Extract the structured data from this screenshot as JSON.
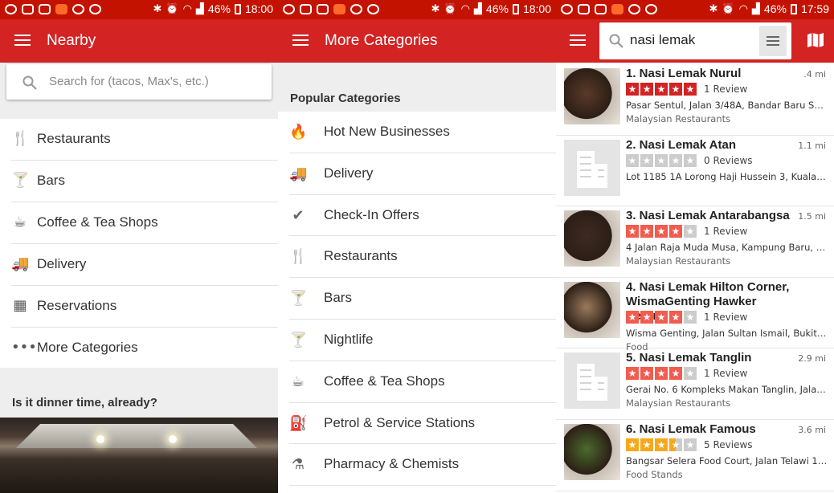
{
  "screen1": {
    "status": {
      "battery": "46%",
      "time": "18:00"
    },
    "title": "Nearby",
    "search_placeholder": "Search for (tacos, Max's, etc.)",
    "items": [
      {
        "icon": "fork-knife-icon",
        "label": "Restaurants"
      },
      {
        "icon": "cocktail-icon",
        "label": "Bars"
      },
      {
        "icon": "coffee-cup-icon",
        "label": "Coffee & Tea Shops"
      },
      {
        "icon": "delivery-truck-icon",
        "label": "Delivery"
      },
      {
        "icon": "calendar-icon",
        "label": "Reservations"
      },
      {
        "icon": "more-dots-icon",
        "label": "More Categories"
      }
    ],
    "section_title": "Is it dinner time, already?"
  },
  "screen2": {
    "status": {
      "battery": "46%",
      "time": "18:00"
    },
    "title": "More Categories",
    "section_title": "Popular Categories",
    "items": [
      {
        "icon": "flame-icon",
        "label": "Hot New Businesses"
      },
      {
        "icon": "delivery-truck-icon",
        "label": "Delivery"
      },
      {
        "icon": "check-badge-icon",
        "label": "Check-In Offers"
      },
      {
        "icon": "fork-knife-icon",
        "label": "Restaurants"
      },
      {
        "icon": "cocktail-icon",
        "label": "Bars"
      },
      {
        "icon": "cocktail-icon",
        "label": "Nightlife"
      },
      {
        "icon": "coffee-cup-icon",
        "label": "Coffee & Tea Shops"
      },
      {
        "icon": "fuel-pump-icon",
        "label": "Petrol & Service Stations"
      },
      {
        "icon": "mortar-pestle-icon",
        "label": "Pharmacy & Chemists"
      }
    ]
  },
  "screen3": {
    "status": {
      "battery": "46%",
      "time": "17:59"
    },
    "query": "nasi lemak",
    "results": [
      {
        "name": "1. Nasi Lemak Nurul",
        "distance": ".4 mi",
        "rating": 5,
        "reviews": "1 Review",
        "address": "Pasar Sentul, Jalan 3/48A, Bandar Baru Sentul,...",
        "category": "Malaysian Restaurants",
        "photo": true,
        "star_color": "#d32323"
      },
      {
        "name": "2. Nasi Lemak Atan",
        "distance": "1.1 mi",
        "rating": 0,
        "reviews": "0 Reviews",
        "address": "Lot 1185 1A Lorong Haji Hussein 3, Kuala Lum...",
        "category": "",
        "photo": false,
        "star_color": "#cccccc"
      },
      {
        "name": "3. Nasi Lemak Antarabangsa",
        "distance": "1.5 mi",
        "rating": 4,
        "reviews": "1 Review",
        "address": "4 Jalan Raja Muda Musa, Kampung Baru, Kuala...",
        "category": "Malaysian Restaurants",
        "photo": true,
        "star_color": "#f15c4f"
      },
      {
        "name": "4. Nasi Lemak Hilton Corner, WismaGenting Hawker Centre",
        "distance": "",
        "rating": 4,
        "reviews": "1 Review",
        "address": "Wisma Genting, Jalan Sultan Ismail, Bukit Bint...",
        "category": "Food",
        "photo": true,
        "star_color": "#f15c4f"
      },
      {
        "name": "5. Nasi Lemak Tanglin",
        "distance": "2.9 mi",
        "rating": 4,
        "reviews": "1 Review",
        "address": "Gerai No. 6 Kompleks Makan Tanglin, Jalan Ce...",
        "category": "Malaysian Restaurants",
        "photo": false,
        "star_color": "#f15c4f"
      },
      {
        "name": "6. Nasi Lemak Famous",
        "distance": "3.6 mi",
        "rating": 3.5,
        "reviews": "5 Reviews",
        "address": "Bangsar Selera Food Court, Jalan Telawi 1, Ba...",
        "category": "Food Stands",
        "photo": true,
        "star_color": "#f8a81c"
      }
    ]
  }
}
